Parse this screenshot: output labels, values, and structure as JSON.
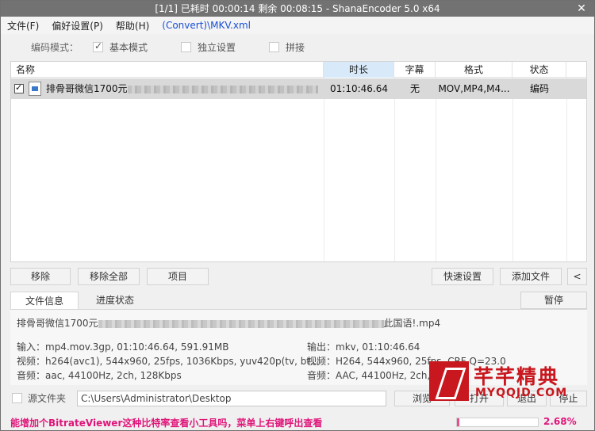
{
  "window": {
    "title": "[1/1] 已耗时 00:00:14  剩余 00:08:15 - ShanaEncoder 5.0 x64",
    "close_glyph": "✕"
  },
  "menu": {
    "file": "文件(F)",
    "prefs": "偏好设置(P)",
    "help": "帮助(H)",
    "preset_path": "(Convert)\\MKV.xml"
  },
  "toolbar": {
    "mode_label": "编码模式：",
    "basic_mode": "基本模式",
    "independent": "独立设置",
    "concat": "拼接"
  },
  "table": {
    "headers": {
      "name": "名称",
      "duration": "时长",
      "subtitle": "字幕",
      "format": "格式",
      "status": "状态"
    },
    "rows": [
      {
        "name": "排骨哥微信1700元",
        "duration": "01:10:46.64",
        "subtitle": "无",
        "format": "MOV,MP4,M4...",
        "status": "编码"
      }
    ]
  },
  "buttons": {
    "remove": "移除",
    "remove_all": "移除全部",
    "item": "项目",
    "quick_settings": "快速设置",
    "add_file": "添加文件",
    "collapse": "<",
    "pause": "暂停",
    "browse": "浏览",
    "open": "打开",
    "exit": "退出",
    "stop": "停止"
  },
  "tabs": {
    "file_info": "文件信息",
    "progress": "进度状态"
  },
  "panel": {
    "file_name_prefix": "排骨哥微信1700元",
    "file_name_suffix": "此国语!.mp4",
    "input": "输入：mp4.mov.3gp, 01:10:46.64, 591.91MB",
    "input_video": "视频：h264(avc1), 544x960, 25fps, 1036Kbps,  yuv420p(tv,  bt...",
    "input_audio": "音频：aac, 44100Hz, 2ch, 128Kbps",
    "output": "输出：mkv, 01:10:46.64",
    "output_video": "视频：H264, 544x960, 25fps, CRF Q=23.0",
    "output_audio": "音频：AAC, 44100Hz, 2ch, 128"
  },
  "source": {
    "label": "源文件夹",
    "path": "C:\\Users\\Administrator\\Desktop"
  },
  "status": {
    "message": "能增加个BitrateViewer这种比特率查看小工具吗，菜单上右键呼出查看",
    "progress_fraction": 0.0268,
    "percent": "2.68%"
  },
  "watermark": {
    "title": "芊芊精典",
    "url": "MYQQJD.COM"
  }
}
